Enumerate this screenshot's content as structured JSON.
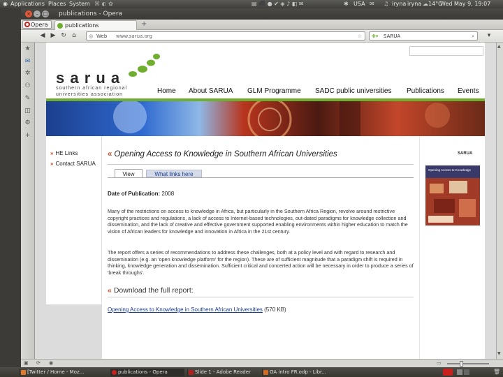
{
  "top_panel": {
    "menus": [
      "Applications",
      "Places",
      "System"
    ],
    "keyboard": "USA",
    "user": "iryna",
    "user2": "iryna",
    "weather": "14°C",
    "clock": "Wed May 9, 19:07"
  },
  "window": {
    "title": "publications - Opera"
  },
  "tabs": {
    "opera_button": "Opera",
    "active_tab": "publications"
  },
  "toolbar": {
    "web_label": "Web",
    "address_value": "www.sarua.org",
    "search_value": "SARUA"
  },
  "site": {
    "logo_text": "s a r u a",
    "logo_tagline_1": "southern african regional",
    "logo_tagline_2": "universities association",
    "nav": [
      "Home",
      "About SARUA",
      "GLM Programme",
      "SADC public universities",
      "Publications",
      "Events"
    ],
    "left_links": [
      "HE Links",
      "Contact SARUA"
    ],
    "page_title": "Opening Access to Knowledge in Southern African Universities",
    "tabs": [
      "View",
      "What links here"
    ],
    "date_label": "Date of Publication:",
    "date_value": "2008",
    "paragraph_1": "Many of the restrictions on access to knowledge in Africa, but particularly in the Southern Africa Region, revolve around restrictive copyright practices and regulations, a lack of access to Internet-based technologies, out-dated paradigms for knowledge collection and dissemination, and the lack of creative and effective government supported enabling environments within higher education to match the vision of African leaders for knowledge and innovation in Africa in the 21st century.",
    "paragraph_2": "The report offers a series of recommendations to address these challenges, both at a policy level and with regard to research and dissemination (e.g. an 'open knowledge platform' for the region). These are of sufficient magnitude that a paradigm shift is required in thinking, knowledge generation and dissemination. Sufficient critical and concerted action will be necessary in order to produce a series of 'break throughs'.",
    "download_heading": "Download the full report:",
    "download_link": "Opening Access to Knowledge in Southern African Universities",
    "download_size": "(570 KB)",
    "cover_logo": "SARUA",
    "cover_title": "Opening Access to Knowledge"
  },
  "taskbar": {
    "items": [
      "[Twitter / Home - Moz...",
      "publications - Opera",
      "Slide 1 - Adobe Reader",
      "OA intro FR.odp - Libr..."
    ]
  },
  "colors": {
    "accent_green": "#6fae2e",
    "accent_orange": "#c8502a",
    "link_blue": "#1a3c8c"
  }
}
